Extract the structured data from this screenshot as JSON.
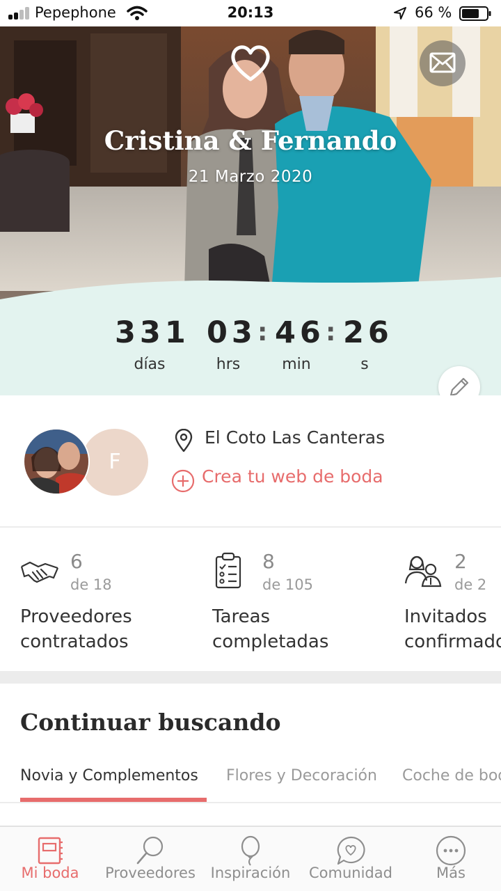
{
  "status_bar": {
    "carrier": "Pepephone",
    "time": "20:13",
    "battery_percent": "66 %",
    "signal_bars": 4,
    "signal_bars_active": 2,
    "battery_level": 0.66
  },
  "hero": {
    "couple_names": "Cristina & Fernando",
    "wedding_date": "21 Marzo 2020",
    "logo_icon": "heart-icon",
    "mail_icon": "mail-icon",
    "background_color": "#e3f3ef"
  },
  "countdown": {
    "days": "331",
    "hours": "03",
    "minutes": "46",
    "seconds": "26",
    "days_label": "días",
    "hours_label": "hrs",
    "minutes_label": "min",
    "seconds_label": "s",
    "edit_icon": "pencil-icon"
  },
  "venue": {
    "avatar_initial": "F",
    "name": "El Coto Las Canteras",
    "web_link": "Crea tu web de boda",
    "pin_icon": "location-pin-icon",
    "plus_icon": "plus-circle-icon"
  },
  "stats": [
    {
      "icon": "handshake-icon",
      "count": "6",
      "total": "de 18",
      "label_line1": "Proveedores",
      "label_line2": "contratados"
    },
    {
      "icon": "checklist-icon",
      "count": "8",
      "total": "de 105",
      "label_line1": "Tareas",
      "label_line2": "completadas"
    },
    {
      "icon": "guests-icon",
      "count": "2",
      "total": "de 2",
      "label_line1": "Invitados",
      "label_line2": "confirmados"
    }
  ],
  "continue_section": {
    "title": "Continuar buscando",
    "tabs": [
      "Novia y Complementos",
      "Flores y Decoración",
      "Coche de boda"
    ],
    "active_tab": 0
  },
  "bottom_nav": {
    "items": [
      {
        "label": "Mi boda",
        "icon": "notebook-icon",
        "active": true
      },
      {
        "label": "Proveedores",
        "icon": "magnifier-icon",
        "active": false
      },
      {
        "label": "Inspiración",
        "icon": "balloon-icon",
        "active": false
      },
      {
        "label": "Comunidad",
        "icon": "chat-heart-icon",
        "active": false
      },
      {
        "label": "Más",
        "icon": "more-icon",
        "active": false
      }
    ]
  },
  "colors": {
    "accent": "#e76c6c",
    "countdown_bg": "#e3f3ef",
    "avatar_initial_bg": "#ecd7ca"
  }
}
